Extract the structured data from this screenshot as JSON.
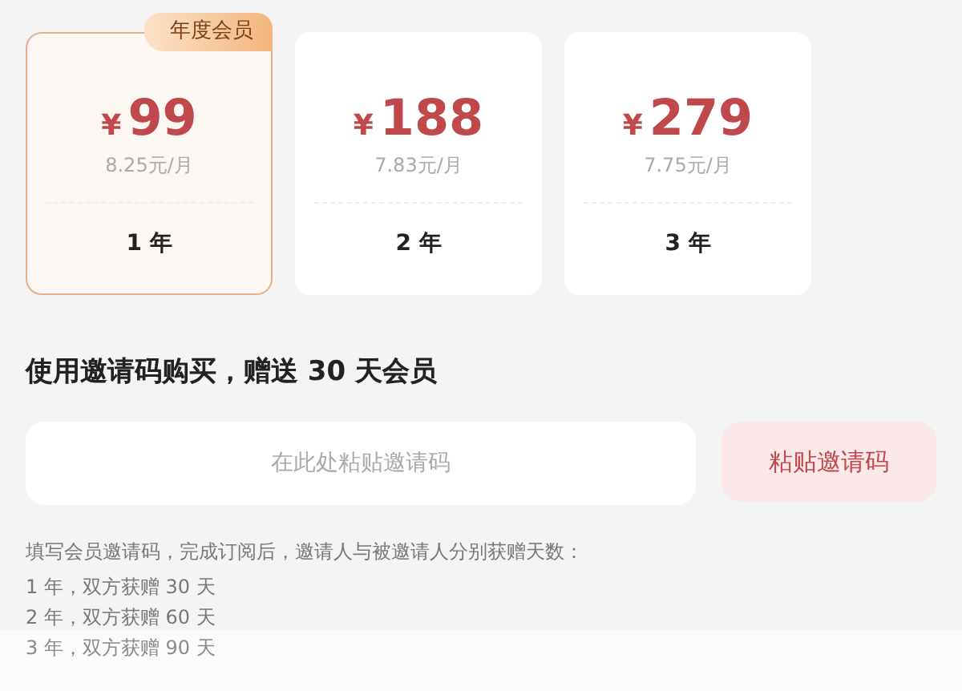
{
  "plans": [
    {
      "badge": "年度会员",
      "price": "99",
      "currency": "¥",
      "monthly": "8.25元/月",
      "term": "1 年",
      "selected": true
    },
    {
      "price": "188",
      "currency": "¥",
      "monthly": "7.83元/月",
      "term": "2 年",
      "selected": false
    },
    {
      "price": "279",
      "currency": "¥",
      "monthly": "7.75元/月",
      "term": "3 年",
      "selected": false
    }
  ],
  "invite": {
    "heading": "使用邀请码购买，赠送 30 天会员",
    "placeholder": "在此处粘贴邀请码",
    "button": "粘贴邀请码"
  },
  "notes": [
    "填写会员邀请码，完成订阅后，邀请人与被邀请人分别获赠天数：",
    "1 年，双方获赠 30 天",
    "2 年，双方获赠 60 天",
    "3 年，双方获赠 90 天"
  ]
}
